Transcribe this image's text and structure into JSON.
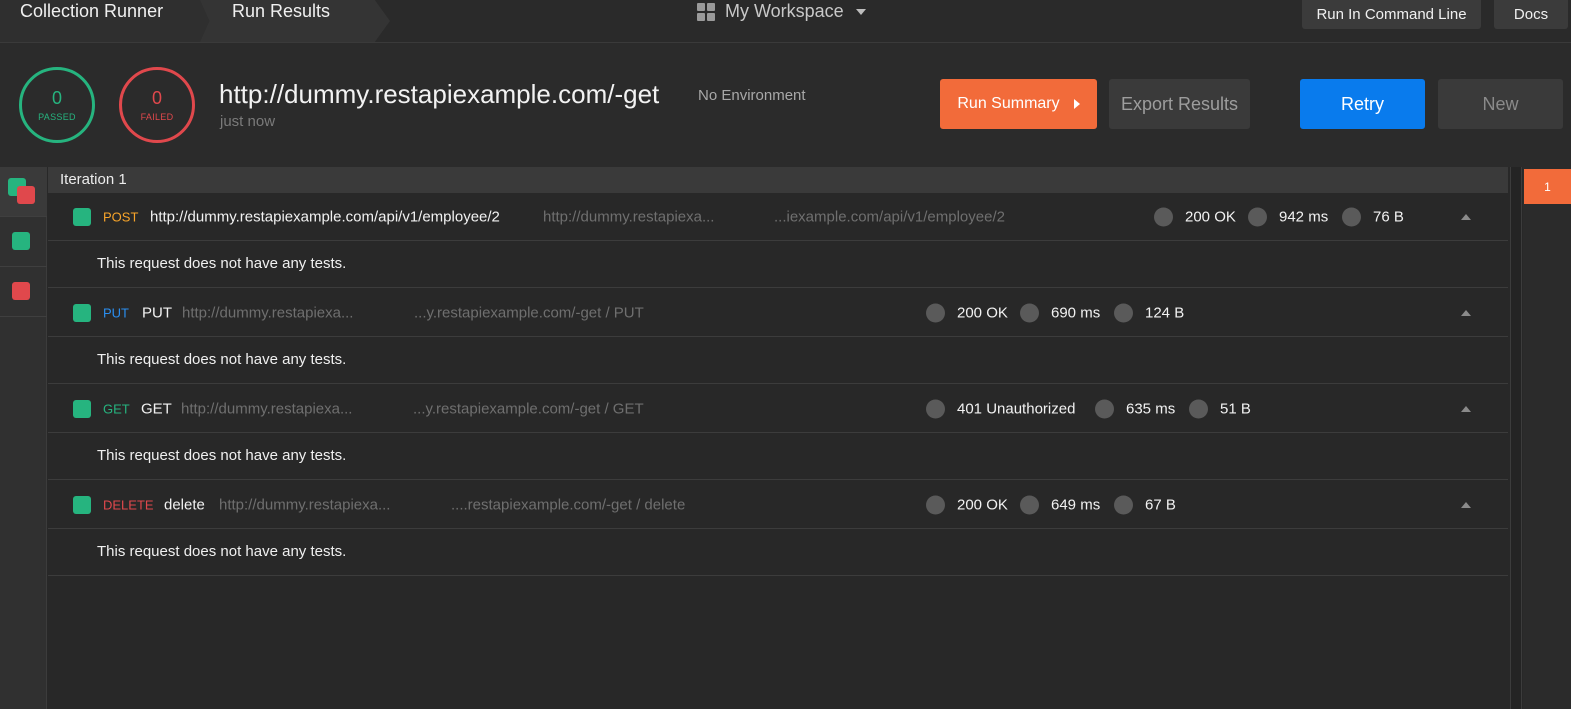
{
  "topbar": {
    "crumb1": "Collection Runner",
    "crumb2": "Run Results",
    "workspace": "My Workspace",
    "run_cmd": "Run In Command Line",
    "docs": "Docs"
  },
  "summary": {
    "passed_count": "0",
    "passed_label": "PASSED",
    "failed_count": "0",
    "failed_label": "FAILED",
    "title": "http://dummy.restapiexample.com/-get",
    "environment": "No Environment",
    "time": "just now"
  },
  "actions": {
    "run_summary": "Run Summary",
    "export": "Export Results",
    "retry": "Retry",
    "new": "New"
  },
  "iteration": {
    "label": "Iteration 1",
    "badge": "1"
  },
  "requests": [
    {
      "method": "POST",
      "name": "http://dummy.restapiexample.com/api/v1/employee/2",
      "url": "http://dummy.restapiexa...",
      "tail": "...iexample.com/api/v1/employee/2",
      "status": "200 OK",
      "time": "942 ms",
      "size": "76 B",
      "note": "This request does not have any tests."
    },
    {
      "method": "PUT",
      "name": "PUT",
      "url": "http://dummy.restapiexa...",
      "tail": "...y.restapiexample.com/-get / PUT",
      "status": "200 OK",
      "time": "690 ms",
      "size": "124 B",
      "note": "This request does not have any tests."
    },
    {
      "method": "GET",
      "name": "GET",
      "url": "http://dummy.restapiexa...",
      "tail": "...y.restapiexample.com/-get / GET",
      "status": "401 Unauthorized",
      "time": "635 ms",
      "size": "51 B",
      "note": "This request does not have any tests."
    },
    {
      "method": "DELETE",
      "name": "delete",
      "url": "http://dummy.restapiexa...",
      "tail": "....restapiexample.com/-get / delete",
      "status": "200 OK",
      "time": "649 ms",
      "size": "67 B",
      "note": "This request does not have any tests."
    }
  ],
  "colors": {
    "pass": "#26b47f",
    "fail": "#e0484c",
    "accent": "#f26b3a",
    "primary": "#097bed"
  }
}
